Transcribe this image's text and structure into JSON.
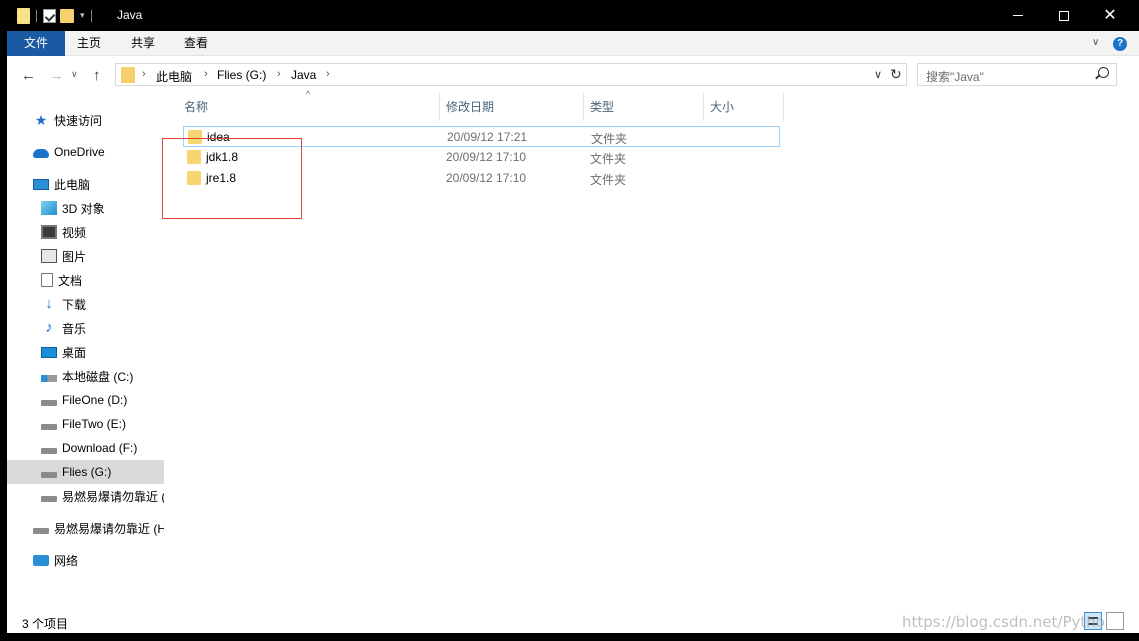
{
  "window": {
    "title": "Java"
  },
  "ribbon": {
    "tabs": [
      "文件",
      "主页",
      "共享",
      "查看"
    ],
    "chevron": "∨",
    "help": "?"
  },
  "nav": {
    "back": "←",
    "forward": "→",
    "recent": "∨",
    "up": "↑"
  },
  "address": {
    "crumbs": [
      "此电脑",
      "Flies (G:)",
      "Java"
    ],
    "separator": "›",
    "dropdown": "∨",
    "refresh": "↻"
  },
  "search": {
    "placeholder": "搜索\"Java\""
  },
  "sidebar": {
    "items": [
      {
        "label": "快速访问",
        "icon": "quick-access-star-icon"
      },
      {
        "label": "OneDrive",
        "icon": "onedrive-cloud-icon"
      },
      {
        "label": "此电脑",
        "icon": "this-pc-icon"
      },
      {
        "label": "3D 对象",
        "icon": "3d-objects-icon"
      },
      {
        "label": "视频",
        "icon": "videos-icon"
      },
      {
        "label": "图片",
        "icon": "pictures-icon"
      },
      {
        "label": "文档",
        "icon": "documents-icon"
      },
      {
        "label": "下载",
        "icon": "downloads-icon"
      },
      {
        "label": "音乐",
        "icon": "music-icon"
      },
      {
        "label": "桌面",
        "icon": "desktop-icon"
      },
      {
        "label": "本地磁盘 (C:)",
        "icon": "local-disk-icon"
      },
      {
        "label": "FileOne (D:)",
        "icon": "drive-icon"
      },
      {
        "label": "FileTwo (E:)",
        "icon": "drive-icon"
      },
      {
        "label": "Download (F:)",
        "icon": "drive-icon"
      },
      {
        "label": "Flies (G:)",
        "icon": "drive-icon",
        "selected": true
      },
      {
        "label": "易燃易爆请勿靠近 (",
        "icon": "drive-icon"
      },
      {
        "label": "易燃易爆请勿靠近 (H",
        "icon": "drive-icon"
      },
      {
        "label": "网络",
        "icon": "network-icon"
      }
    ]
  },
  "columns": {
    "name": "名称",
    "date": "修改日期",
    "type": "类型",
    "size": "大小",
    "sort_indicator": "^"
  },
  "files": [
    {
      "name": "idea",
      "date": "20/09/12 17:21",
      "type": "文件夹",
      "size": ""
    },
    {
      "name": "jdk1.8",
      "date": "20/09/12 17:10",
      "type": "文件夹",
      "size": ""
    },
    {
      "name": "jre1.8",
      "date": "20/09/12 17:10",
      "type": "文件夹",
      "size": ""
    }
  ],
  "status": {
    "item_count": "3 个项目"
  },
  "watermark": "https://blog.csdn.net/Pytho",
  "colors": {
    "file_tab": "#1a5aa3",
    "selection_highlight": "#d9d9d9",
    "focus_border": "#99d1ff",
    "annotation_box": "#e0443a"
  }
}
